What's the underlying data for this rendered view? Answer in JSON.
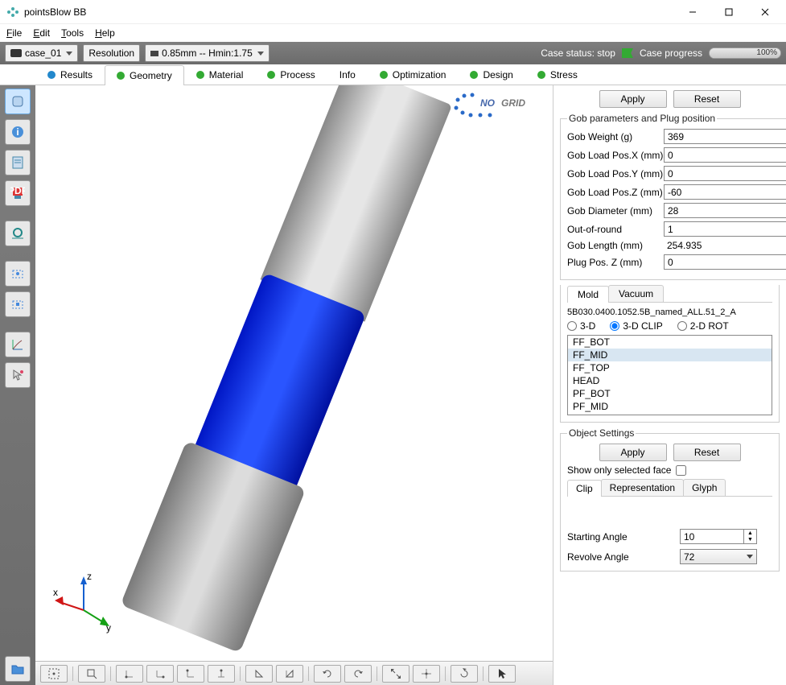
{
  "window": {
    "title": "pointsBlow BB"
  },
  "menubar": {
    "file": "File",
    "edit": "Edit",
    "tools": "Tools",
    "help": "Help"
  },
  "toolbar": {
    "case_label": "case_01",
    "resolution_label": "Resolution",
    "resolution_value": "0.85mm -- Hmin:1.75",
    "status_label": "Case status: stop",
    "progress_label": "Case progress",
    "progress_value": "100%"
  },
  "tabs": {
    "results": "Results",
    "geometry": "Geometry",
    "material": "Material",
    "process": "Process",
    "info": "Info",
    "optimization": "Optimization",
    "design": "Design",
    "stress": "Stress",
    "active": "geometry"
  },
  "viewport": {
    "logo_text_1": "NO",
    "logo_text_2": "GRID",
    "axes": {
      "x": "x",
      "y": "y",
      "z": "z"
    }
  },
  "panel": {
    "apply": "Apply",
    "reset": "Reset",
    "gob_group": "Gob parameters and Plug position",
    "fields": {
      "gob_weight_label": "Gob Weight (g)",
      "gob_weight": "369",
      "gob_load_x_label": "Gob Load Pos.X (mm)",
      "gob_load_x": "0",
      "gob_load_y_label": "Gob Load Pos.Y (mm)",
      "gob_load_y": "0",
      "gob_load_z_label": "Gob Load Pos.Z (mm)",
      "gob_load_z": "-60",
      "gob_diameter_label": "Gob Diameter (mm)",
      "gob_diameter": "28",
      "out_of_round_label": "Out-of-round",
      "out_of_round": "1",
      "gob_length_label": "Gob Length (mm)",
      "gob_length": "254.935",
      "plug_pos_z_label": "Plug Pos. Z (mm)",
      "plug_pos_z": "0"
    },
    "subtabs": {
      "mold": "Mold",
      "vacuum": "Vacuum"
    },
    "filename": "5B030.0400.1052.5B_named_ALL.51_2_A",
    "view_modes": {
      "d3": "3-D",
      "clip": "3-D CLIP",
      "rot": "2-D ROT"
    },
    "list": [
      "FF_BOT",
      "FF_MID",
      "FF_TOP",
      "HEAD",
      "PF_BOT",
      "PF_MID"
    ],
    "list_selected": "FF_MID",
    "object_settings_label": "Object Settings",
    "show_face_label": "Show only selected face",
    "subtabs2": {
      "clip": "Clip",
      "rep": "Representation",
      "glyph": "Glyph"
    },
    "starting_angle_label": "Starting Angle",
    "starting_angle": "10",
    "revolve_angle_label": "Revolve Angle",
    "revolve_angle": "72"
  }
}
